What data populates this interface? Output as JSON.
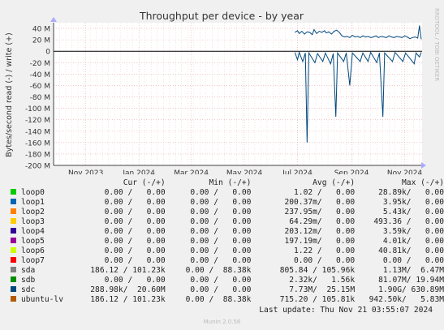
{
  "chart_data": {
    "type": "line",
    "title": "Throughput per device - by year",
    "ylabel": "Bytes/second read (-) / write (+)",
    "watermark": "RRDTOOL / TOBI OETIKER",
    "ylim": [
      -200000000,
      50000000
    ],
    "yticks": [
      {
        "v": 40000000,
        "label": "40 M"
      },
      {
        "v": 20000000,
        "label": "20 M"
      },
      {
        "v": 0,
        "label": "0"
      },
      {
        "v": -20000000,
        "label": "-20 M"
      },
      {
        "v": -40000000,
        "label": "-40 M"
      },
      {
        "v": -60000000,
        "label": "-60 M"
      },
      {
        "v": -80000000,
        "label": "-80 M"
      },
      {
        "v": -100000000,
        "label": "-100 M"
      },
      {
        "v": -120000000,
        "label": "-120 M"
      },
      {
        "v": -140000000,
        "label": "-140 M"
      },
      {
        "v": -160000000,
        "label": "-160 M"
      },
      {
        "v": -180000000,
        "label": "-180 M"
      },
      {
        "v": -200000000,
        "label": "-200 M"
      }
    ],
    "xlim": [
      "2023-09-25",
      "2024-11-21"
    ],
    "xticks": [
      {
        "date": "2023-11-01",
        "label": "Nov 2023"
      },
      {
        "date": "2024-01-01",
        "label": "Jan 2024"
      },
      {
        "date": "2024-03-01",
        "label": "Mar 2024"
      },
      {
        "date": "2024-05-01",
        "label": "May 2024"
      },
      {
        "date": "2024-07-01",
        "label": "Jul 2024"
      },
      {
        "date": "2024-09-01",
        "label": "Sep 2024"
      },
      {
        "date": "2024-11-01",
        "label": "Nov 2024"
      }
    ],
    "series": [
      {
        "name": "sdc",
        "color": "#00487d",
        "write": [
          [
            "2024-06-28",
            33000000
          ],
          [
            "2024-07-01",
            36000000
          ],
          [
            "2024-07-03",
            31000000
          ],
          [
            "2024-07-06",
            35000000
          ],
          [
            "2024-07-09",
            30000000
          ],
          [
            "2024-07-12",
            34000000
          ],
          [
            "2024-07-15",
            33000000
          ],
          [
            "2024-07-18",
            29000000
          ],
          [
            "2024-07-20",
            38000000
          ],
          [
            "2024-07-23",
            31000000
          ],
          [
            "2024-07-26",
            35000000
          ],
          [
            "2024-07-29",
            33000000
          ],
          [
            "2024-08-01",
            36000000
          ],
          [
            "2024-08-03",
            32000000
          ],
          [
            "2024-08-06",
            34000000
          ],
          [
            "2024-08-09",
            30000000
          ],
          [
            "2024-08-12",
            35000000
          ],
          [
            "2024-08-15",
            37000000
          ],
          [
            "2024-08-18",
            33000000
          ],
          [
            "2024-08-21",
            27000000
          ],
          [
            "2024-08-24",
            25000000
          ],
          [
            "2024-08-27",
            26000000
          ],
          [
            "2024-08-30",
            24000000
          ],
          [
            "2024-09-02",
            28000000
          ],
          [
            "2024-09-05",
            25000000
          ],
          [
            "2024-09-08",
            26000000
          ],
          [
            "2024-09-11",
            24000000
          ],
          [
            "2024-09-14",
            27000000
          ],
          [
            "2024-09-17",
            25000000
          ],
          [
            "2024-09-20",
            26000000
          ],
          [
            "2024-09-23",
            24000000
          ],
          [
            "2024-09-26",
            25000000
          ],
          [
            "2024-09-29",
            27000000
          ],
          [
            "2024-10-02",
            24000000
          ],
          [
            "2024-10-05",
            26000000
          ],
          [
            "2024-10-08",
            25000000
          ],
          [
            "2024-10-11",
            24000000
          ],
          [
            "2024-10-14",
            27000000
          ],
          [
            "2024-10-17",
            25000000
          ],
          [
            "2024-10-20",
            24000000
          ],
          [
            "2024-10-23",
            26000000
          ],
          [
            "2024-10-26",
            25000000
          ],
          [
            "2024-10-29",
            24000000
          ],
          [
            "2024-11-01",
            27000000
          ],
          [
            "2024-11-04",
            25000000
          ],
          [
            "2024-11-07",
            22000000
          ],
          [
            "2024-11-10",
            24000000
          ],
          [
            "2024-11-13",
            25000000
          ],
          [
            "2024-11-16",
            23000000
          ],
          [
            "2024-11-18",
            45000000
          ],
          [
            "2024-11-20",
            21000000
          ]
        ],
        "read": [
          [
            "2024-06-28",
            -2000000
          ],
          [
            "2024-07-01",
            -15000000
          ],
          [
            "2024-07-03",
            -2000000
          ],
          [
            "2024-07-07",
            -18000000
          ],
          [
            "2024-07-10",
            -3000000
          ],
          [
            "2024-07-12",
            -160000000
          ],
          [
            "2024-07-14",
            -3000000
          ],
          [
            "2024-07-21",
            -20000000
          ],
          [
            "2024-07-24",
            -4000000
          ],
          [
            "2024-07-30",
            -18000000
          ],
          [
            "2024-08-02",
            -3000000
          ],
          [
            "2024-08-08",
            -22000000
          ],
          [
            "2024-08-11",
            -4000000
          ],
          [
            "2024-08-14",
            -115000000
          ],
          [
            "2024-08-16",
            -3000000
          ],
          [
            "2024-08-23",
            -18000000
          ],
          [
            "2024-08-26",
            -3000000
          ],
          [
            "2024-08-30",
            -60000000
          ],
          [
            "2024-09-02",
            -3000000
          ],
          [
            "2024-09-11",
            -18000000
          ],
          [
            "2024-09-14",
            -3000000
          ],
          [
            "2024-09-20",
            -18000000
          ],
          [
            "2024-09-23",
            -2000000
          ],
          [
            "2024-09-30",
            -20000000
          ],
          [
            "2024-10-03",
            -3000000
          ],
          [
            "2024-10-07",
            -115000000
          ],
          [
            "2024-10-09",
            -3000000
          ],
          [
            "2024-10-18",
            -18000000
          ],
          [
            "2024-10-21",
            -2000000
          ],
          [
            "2024-10-30",
            -18000000
          ],
          [
            "2024-11-02",
            -3000000
          ],
          [
            "2024-11-12",
            -22000000
          ],
          [
            "2024-11-14",
            -3000000
          ],
          [
            "2024-11-18",
            -10000000
          ],
          [
            "2024-11-20",
            -2000000
          ]
        ]
      }
    ],
    "legend": {
      "header": {
        "cur": "Cur (-/+)",
        "min": "Min (-/+)",
        "avg": "Avg (-/+)",
        "max": "Max (-/+)"
      },
      "rows": [
        {
          "name": "loop0",
          "color": "#00cc00",
          "cur": "0.00 /   0.00",
          "min": "0.00 /   0.00",
          "avg": "1.02 /   0.00",
          "max": "28.89k/   0.00"
        },
        {
          "name": "loop1",
          "color": "#0066b3",
          "cur": "0.00 /   0.00",
          "min": "0.00 /   0.00",
          "avg": "200.37m/   0.00",
          "max": "3.95k/   0.00"
        },
        {
          "name": "loop2",
          "color": "#ff8000",
          "cur": "0.00 /   0.00",
          "min": "0.00 /   0.00",
          "avg": "237.95m/   0.00",
          "max": "5.43k/   0.00"
        },
        {
          "name": "loop3",
          "color": "#ffcc00",
          "cur": "0.00 /   0.00",
          "min": "0.00 /   0.00",
          "avg": "64.29m/   0.00",
          "max": "493.36 /   0.00"
        },
        {
          "name": "loop4",
          "color": "#330099",
          "cur": "0.00 /   0.00",
          "min": "0.00 /   0.00",
          "avg": "203.12m/   0.00",
          "max": "3.59k/   0.00"
        },
        {
          "name": "loop5",
          "color": "#990099",
          "cur": "0.00 /   0.00",
          "min": "0.00 /   0.00",
          "avg": "197.19m/   0.00",
          "max": "4.01k/   0.00"
        },
        {
          "name": "loop6",
          "color": "#ccff00",
          "cur": "0.00 /   0.00",
          "min": "0.00 /   0.00",
          "avg": "1.22 /   0.00",
          "max": "40.81k/   0.00"
        },
        {
          "name": "loop7",
          "color": "#ff0000",
          "cur": "0.00 /   0.00",
          "min": "0.00 /   0.00",
          "avg": "0.00 /   0.00",
          "max": "0.00 /   0.00"
        },
        {
          "name": "sda",
          "color": "#808080",
          "cur": "186.12 / 101.23k",
          "min": "0.00 /  88.38k",
          "avg": "805.84 / 105.96k",
          "max": "1.13M/  6.47M"
        },
        {
          "name": "sdb",
          "color": "#008f00",
          "cur": "0.00 /   0.00",
          "min": "0.00 /   0.00",
          "avg": "2.32k/   1.56k",
          "max": "81.07M/ 19.94M"
        },
        {
          "name": "sdc",
          "color": "#00487d",
          "cur": "288.98k/  20.60M",
          "min": "0.00 /   0.00",
          "avg": "7.73M/  25.15M",
          "max": "1.90G/ 630.89M"
        },
        {
          "name": "ubuntu-lv",
          "color": "#b35a00",
          "cur": "186.12 / 101.23k",
          "min": "0.00 /  88.38k",
          "avg": "715.20 / 105.81k",
          "max": "942.50k/   5.83M"
        }
      ]
    }
  },
  "last_update": "Last update: Thu Nov 21 03:55:07 2024",
  "footer": "Munin 2.0.56"
}
